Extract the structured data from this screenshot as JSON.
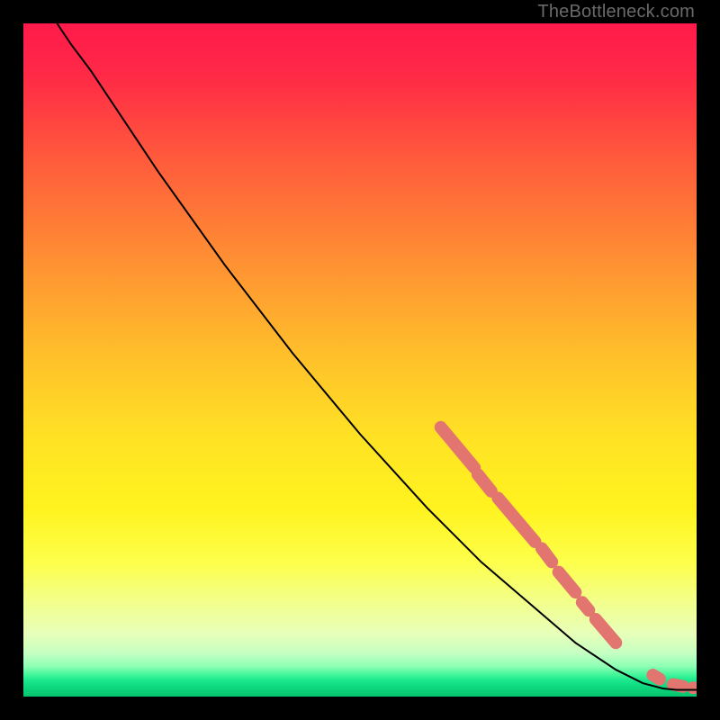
{
  "watermark": "TheBottleneck.com",
  "chart_data": {
    "type": "line",
    "title": "",
    "xlabel": "",
    "ylabel": "",
    "xlim": [
      0,
      100
    ],
    "ylim": [
      0,
      100
    ],
    "grid": false,
    "legend": false,
    "gradient_stops": [
      {
        "offset": 0.0,
        "color": "#ff1a4b"
      },
      {
        "offset": 0.08,
        "color": "#ff2a46"
      },
      {
        "offset": 0.2,
        "color": "#ff5a3c"
      },
      {
        "offset": 0.35,
        "color": "#ff8f33"
      },
      {
        "offset": 0.5,
        "color": "#ffc22a"
      },
      {
        "offset": 0.62,
        "color": "#ffe324"
      },
      {
        "offset": 0.72,
        "color": "#fff31f"
      },
      {
        "offset": 0.8,
        "color": "#fdff4a"
      },
      {
        "offset": 0.86,
        "color": "#f2ff8c"
      },
      {
        "offset": 0.905,
        "color": "#e8ffb8"
      },
      {
        "offset": 0.935,
        "color": "#c7ffc3"
      },
      {
        "offset": 0.955,
        "color": "#8dffb4"
      },
      {
        "offset": 0.968,
        "color": "#41f59a"
      },
      {
        "offset": 0.975,
        "color": "#1ee98e"
      },
      {
        "offset": 0.985,
        "color": "#0fd97f"
      },
      {
        "offset": 1.0,
        "color": "#03c46d"
      }
    ],
    "series": [
      {
        "name": "curve",
        "type": "line",
        "color": "#000000",
        "width": 2,
        "points": [
          {
            "x": 5,
            "y": 100
          },
          {
            "x": 7,
            "y": 97
          },
          {
            "x": 10,
            "y": 93
          },
          {
            "x": 14,
            "y": 87
          },
          {
            "x": 20,
            "y": 78
          },
          {
            "x": 30,
            "y": 64
          },
          {
            "x": 40,
            "y": 51
          },
          {
            "x": 50,
            "y": 39
          },
          {
            "x": 60,
            "y": 28
          },
          {
            "x": 68,
            "y": 20
          },
          {
            "x": 75,
            "y": 14
          },
          {
            "x": 82,
            "y": 8
          },
          {
            "x": 88,
            "y": 4
          },
          {
            "x": 92,
            "y": 2
          },
          {
            "x": 95,
            "y": 1.2
          },
          {
            "x": 97,
            "y": 1
          },
          {
            "x": 100,
            "y": 1
          }
        ]
      },
      {
        "name": "highlight-segments",
        "type": "scatter",
        "color": "#e2756f",
        "radius": 7,
        "segments": [
          {
            "x1": 62,
            "y1": 40,
            "x2": 67,
            "y2": 34
          },
          {
            "x1": 67.5,
            "y1": 33,
            "x2": 69.5,
            "y2": 30.5
          },
          {
            "x1": 70.5,
            "y1": 29.5,
            "x2": 76,
            "y2": 23
          },
          {
            "x1": 77,
            "y1": 22,
            "x2": 78.5,
            "y2": 20
          },
          {
            "x1": 79.5,
            "y1": 18.5,
            "x2": 82,
            "y2": 15.5
          },
          {
            "x1": 83,
            "y1": 14,
            "x2": 84,
            "y2": 12.8
          },
          {
            "x1": 85,
            "y1": 11.5,
            "x2": 88,
            "y2": 8
          },
          {
            "x1": 93.5,
            "y1": 3.2,
            "x2": 94.5,
            "y2": 2.6
          },
          {
            "x1": 96.5,
            "y1": 1.8,
            "x2": 98,
            "y2": 1.5
          }
        ],
        "points": [
          {
            "x": 99.5,
            "y": 1.3
          }
        ]
      }
    ]
  }
}
